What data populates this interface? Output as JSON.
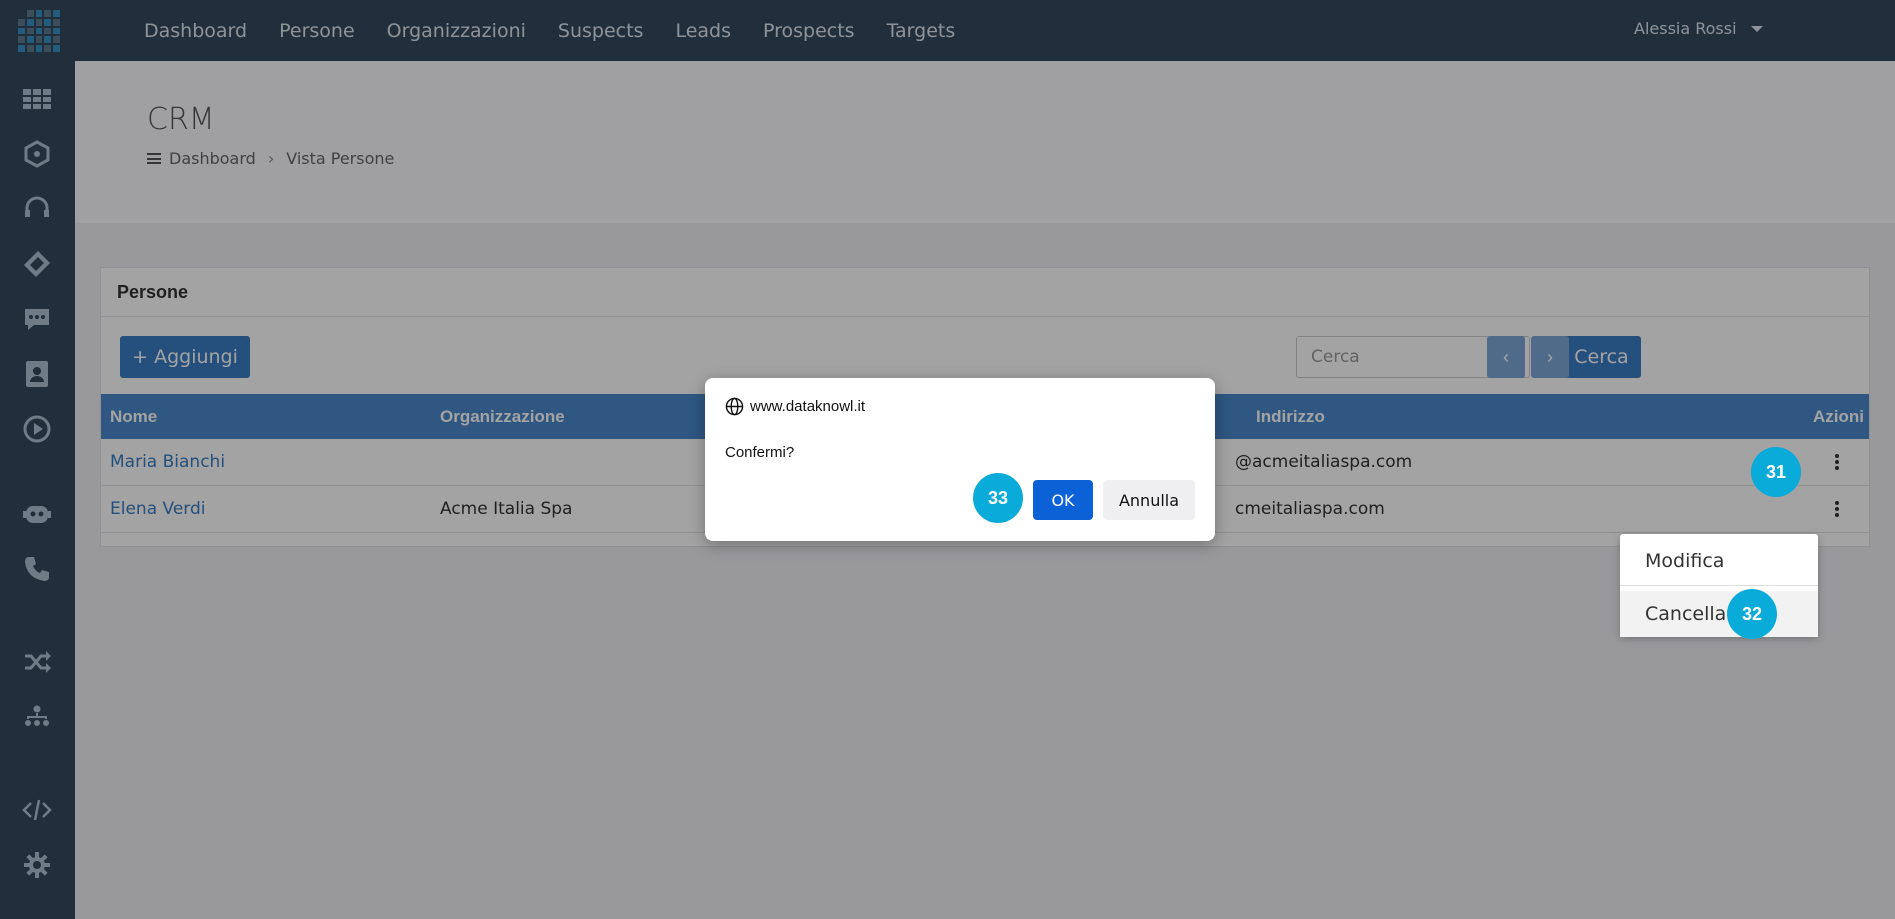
{
  "topnav": {
    "items": [
      "Dashboard",
      "Persone",
      "Organizzazioni",
      "Suspects",
      "Leads",
      "Prospects",
      "Targets"
    ],
    "user_name": "Alessia Rossi"
  },
  "sidebar": {
    "icons": [
      "apps-grid-icon",
      "hexagon-cube-icon",
      "headset-icon",
      "ticket-icon",
      "chat-icon",
      "contacts-icon",
      "play-icon",
      "bot-icon",
      "phone-icon",
      "shuffle-icon",
      "org-chart-icon",
      "code-icon",
      "gear-icon"
    ]
  },
  "header": {
    "title": "CRM",
    "breadcrumb": [
      "Dashboard",
      "Vista Persone"
    ]
  },
  "panel": {
    "title": "Persone",
    "add_button": "+ Aggiungi",
    "search_placeholder": "Cerca",
    "search_button": "Cerca",
    "prev_label": "‹",
    "next_label": "›"
  },
  "table": {
    "columns": [
      "Nome",
      "Organizzazione",
      "Indirizzo",
      "Azioni"
    ],
    "rows": [
      {
        "nome": "Maria Bianchi",
        "organizzazione": "",
        "email_fragment": "@acmeitaliaspa.com"
      },
      {
        "nome": "Elena Verdi",
        "organizzazione": "Acme Italia Spa",
        "email_fragment": "cmeitaliaspa.com"
      }
    ]
  },
  "dropdown": {
    "items": [
      "Modifica",
      "Cancella"
    ]
  },
  "dialog": {
    "origin": "www.dataknowl.it",
    "message": "Confermi?",
    "ok": "OK",
    "cancel": "Annulla"
  },
  "badges": {
    "b31": "31",
    "b32": "32",
    "b33": "33"
  },
  "colors": {
    "topbar": "#34495e",
    "primary": "#3a7cc4",
    "badge": "#0aabd9",
    "dialog_ok": "#0b62d6"
  }
}
